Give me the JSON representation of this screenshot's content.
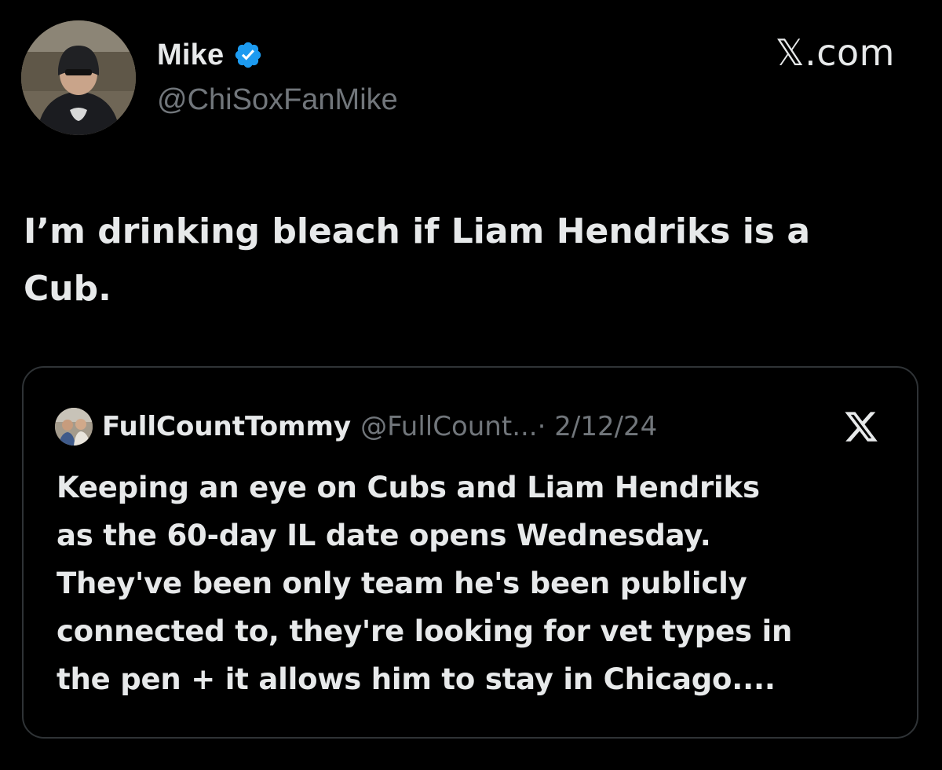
{
  "author": {
    "display_name": "Mike",
    "handle": "@ChiSoxFanMike",
    "verified": true,
    "avatar_icon": "profile-photo"
  },
  "site_label": "𝕏.com",
  "tweet": {
    "lines": [
      "I’m drinking bleach if Liam Hendriks is a",
      "Cub."
    ]
  },
  "quoted_tweet": {
    "display_name": "FullCountTommy",
    "handle": "@FullCount...",
    "date": " · 2/12/24",
    "avatar_icon": "profile-photo",
    "lines": [
      "Keeping an eye on Cubs and Liam Hendriks",
      "as the 60-day IL date opens Wednesday.",
      "They've been only team he's been publicly",
      "connected to, they're looking for vet types in",
      "the pen + it allows him to stay in Chicago...."
    ],
    "source_icon": "x-logo-icon"
  },
  "colors": {
    "background": "#000000",
    "text_primary": "#e7e9ea",
    "text_secondary": "#71767b",
    "verified_blue": "#1d9bf0",
    "card_border": "#2f3336"
  }
}
